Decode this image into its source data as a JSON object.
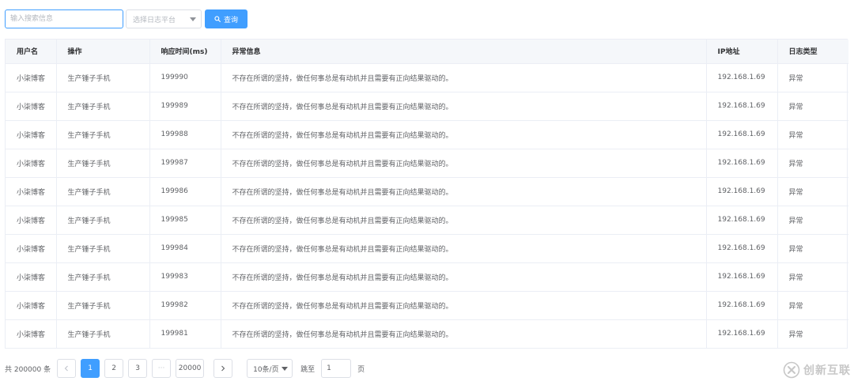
{
  "toolbar": {
    "search_placeholder": "输入搜索信息",
    "select_placeholder": "选择日志平台",
    "query_label": "查询"
  },
  "table": {
    "columns": [
      "用户名",
      "操作",
      "响应时间(ms)",
      "异常信息",
      "IP地址",
      "日志类型"
    ],
    "rows": [
      [
        "小柒博客",
        "生产锤子手机",
        "199990",
        "不存在所谓的坚持，做任何事总是有动机并且需要有正向结果驱动的。",
        "192.168.1.69",
        "异常"
      ],
      [
        "小柒博客",
        "生产锤子手机",
        "199989",
        "不存在所谓的坚持，做任何事总是有动机并且需要有正向结果驱动的。",
        "192.168.1.69",
        "异常"
      ],
      [
        "小柒博客",
        "生产锤子手机",
        "199988",
        "不存在所谓的坚持，做任何事总是有动机并且需要有正向结果驱动的。",
        "192.168.1.69",
        "异常"
      ],
      [
        "小柒博客",
        "生产锤子手机",
        "199987",
        "不存在所谓的坚持，做任何事总是有动机并且需要有正向结果驱动的。",
        "192.168.1.69",
        "异常"
      ],
      [
        "小柒博客",
        "生产锤子手机",
        "199986",
        "不存在所谓的坚持，做任何事总是有动机并且需要有正向结果驱动的。",
        "192.168.1.69",
        "异常"
      ],
      [
        "小柒博客",
        "生产锤子手机",
        "199985",
        "不存在所谓的坚持，做任何事总是有动机并且需要有正向结果驱动的。",
        "192.168.1.69",
        "异常"
      ],
      [
        "小柒博客",
        "生产锤子手机",
        "199984",
        "不存在所谓的坚持，做任何事总是有动机并且需要有正向结果驱动的。",
        "192.168.1.69",
        "异常"
      ],
      [
        "小柒博客",
        "生产锤子手机",
        "199983",
        "不存在所谓的坚持，做任何事总是有动机并且需要有正向结果驱动的。",
        "192.168.1.69",
        "异常"
      ],
      [
        "小柒博客",
        "生产锤子手机",
        "199982",
        "不存在所谓的坚持，做任何事总是有动机并且需要有正向结果驱动的。",
        "192.168.1.69",
        "异常"
      ],
      [
        "小柒博客",
        "生产锤子手机",
        "199981",
        "不存在所谓的坚持，做任何事总是有动机并且需要有正向结果驱动的。",
        "192.168.1.69",
        "异常"
      ]
    ]
  },
  "pagination": {
    "total_label": "共 200000 条",
    "pages": [
      "1",
      "2",
      "3"
    ],
    "ellipsis": "···",
    "last_page": "20000",
    "current": "1",
    "page_size": "10条/页",
    "jump_label": "跳至",
    "jump_value": "1",
    "page_unit": "页"
  },
  "watermark": {
    "text": "创新互联"
  },
  "colors": {
    "primary": "#409eff",
    "border": "#ebeef5",
    "header_bg": "#f5f7fa"
  }
}
